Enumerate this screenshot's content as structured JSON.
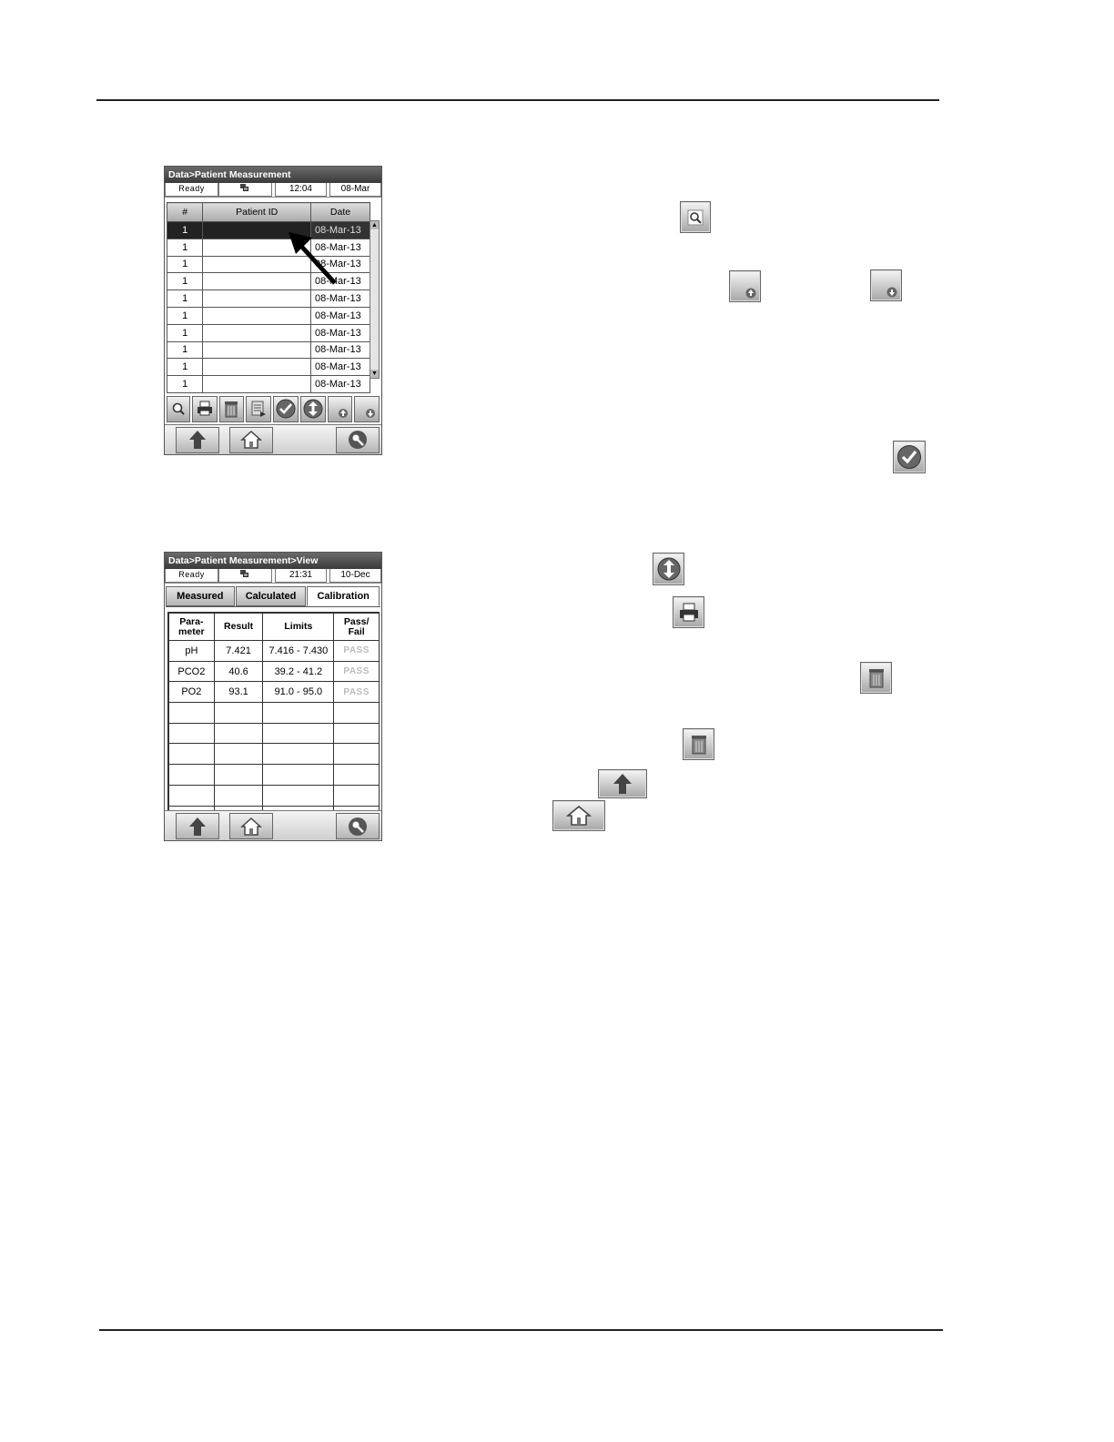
{
  "screen_list": {
    "title": "Data>Patient Measurement",
    "status": {
      "state": "Ready",
      "time": "12:04",
      "date": "08-Mar"
    },
    "columns": [
      "#",
      "Patient ID",
      "Date"
    ],
    "rows": [
      {
        "num": "1",
        "patient_id": "",
        "date": "08-Mar-13",
        "selected": true
      },
      {
        "num": "1",
        "patient_id": "",
        "date": "08-Mar-13"
      },
      {
        "num": "1",
        "patient_id": "",
        "date": "08-Mar-13"
      },
      {
        "num": "1",
        "patient_id": "",
        "date": "08-Mar-13"
      },
      {
        "num": "1",
        "patient_id": "",
        "date": "08-Mar-13"
      },
      {
        "num": "1",
        "patient_id": "",
        "date": "08-Mar-13"
      },
      {
        "num": "1",
        "patient_id": "",
        "date": "08-Mar-13"
      },
      {
        "num": "1",
        "patient_id": "",
        "date": "08-Mar-13"
      },
      {
        "num": "1",
        "patient_id": "",
        "date": "08-Mar-13"
      },
      {
        "num": "1",
        "patient_id": "",
        "date": "08-Mar-13"
      }
    ],
    "toolbar_icons": [
      "magnifier-icon",
      "printer-icon",
      "trash-icon",
      "export-icon",
      "checkmark-icon",
      "up-down-icon",
      "page-up-icon",
      "page-down-icon"
    ]
  },
  "screen_view": {
    "title": "Data>Patient Measurement>View",
    "status": {
      "state": "Ready",
      "time": "21:31",
      "date": "10-Dec"
    },
    "tabs": [
      "Measured",
      "Calculated",
      "Calibration"
    ],
    "active_tab": "Calibration",
    "headers": {
      "param_1": "Para-",
      "param_2": "meter",
      "result": "Result",
      "limits": "Limits",
      "pf_1": "Pass/",
      "pf_2": "Fail"
    },
    "rows": [
      {
        "param": "pH",
        "result": "7.421",
        "limits": "7.416 - 7.430",
        "pass_fail": "PASS"
      },
      {
        "param": "PCO2",
        "result": "40.6",
        "limits": "39.2 - 41.2",
        "pass_fail": "PASS"
      },
      {
        "param": "PO2",
        "result": "93.1",
        "limits": "91.0 - 95.0",
        "pass_fail": "PASS"
      }
    ]
  },
  "nav_icons": [
    "up-arrow-icon",
    "home-icon",
    "key-icon"
  ],
  "inline_icons": [
    "magnifier-icon",
    "page-up-icon",
    "page-down-icon",
    "checkmark-icon",
    "up-down-icon",
    "printer-icon",
    "trash-icon",
    "trash-icon",
    "up-arrow-icon",
    "home-icon"
  ],
  "colors": {
    "titlebar": "#3a3a3a",
    "button_light": "#f2f2f2",
    "button_dark": "#a8a8a8",
    "selected_row": "#222222"
  }
}
